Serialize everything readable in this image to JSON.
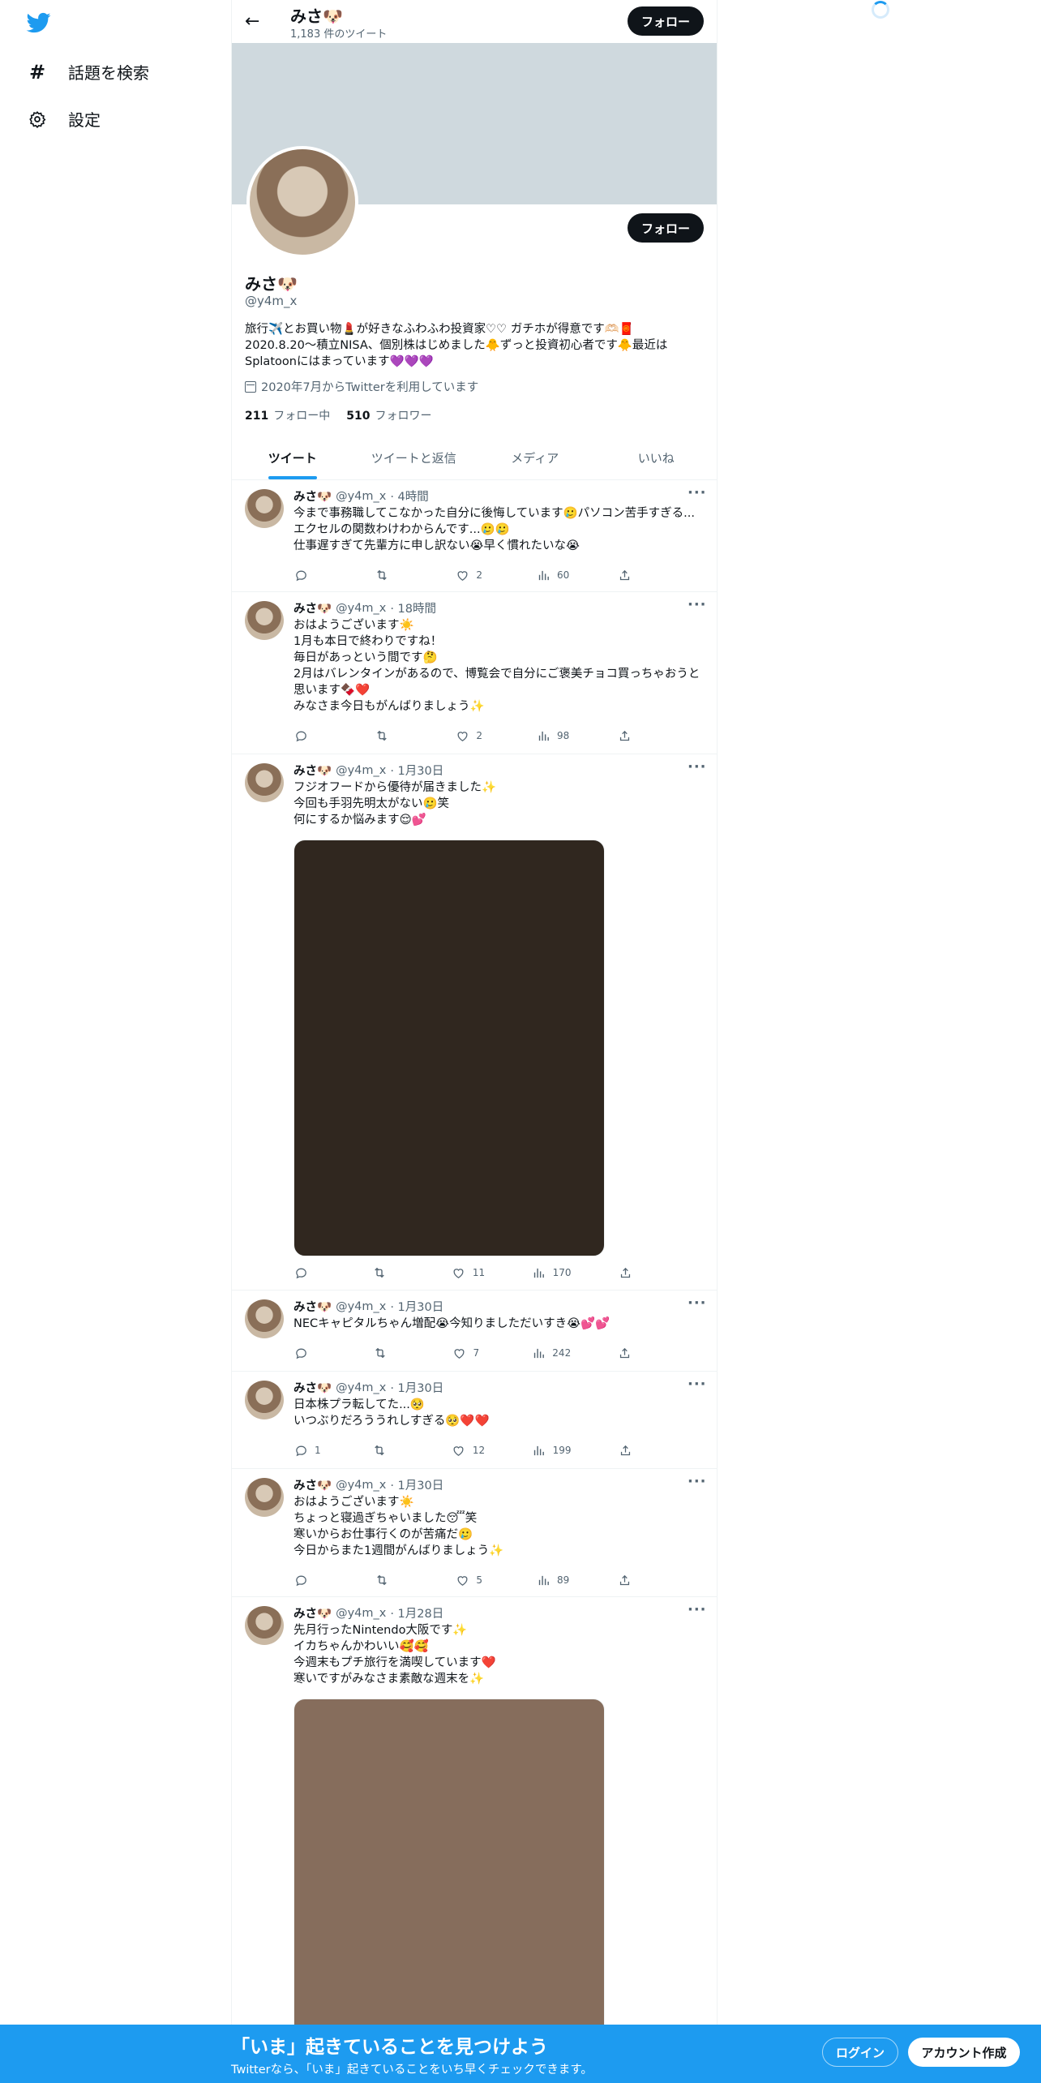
{
  "nav": {
    "logo": "twitter-bird-icon",
    "items": [
      {
        "label": "話題を検索",
        "icon": "hashtag-icon"
      },
      {
        "label": "設定",
        "icon": "gear-icon"
      }
    ]
  },
  "header": {
    "name": "みさ🐶",
    "tweet_count": "1,183 件のツイート",
    "follow_label": "フォロー"
  },
  "profile": {
    "name": "みさ🐶",
    "handle": "@y4m_x",
    "follow_label": "フォロー",
    "bio": "旅行✈️とお買い物💄が好きなふわふわ投資家♡♡ ガチホが得意です🫶🏻🧧\n2020.8.20〜積立NISA、個別株はじめました🐥ずっと投資初心者です🐥最近は\nSplatoonにはまっています💜💜💜",
    "joined": "2020年7月からTwitterを利用しています",
    "following_count": "211",
    "following_label": "フォロー中",
    "followers_count": "510",
    "followers_label": "フォロワー"
  },
  "tabs": [
    "ツイート",
    "ツイートと返信",
    "メディア",
    "いいね"
  ],
  "tweets": [
    {
      "name": "みさ🐶",
      "handle": "@y4m_x",
      "time": "· 4時間",
      "text": "今まで事務職してこなかった自分に後悔しています🥲パソコン苦手すぎる...エクセルの関数わけわからんです...🥲🥲\n仕事遅すぎて先輩方に申し訳ない😭早く慣れたいな😭",
      "replies": "",
      "retweets": "",
      "likes": "2",
      "views": "60"
    },
    {
      "name": "みさ🐶",
      "handle": "@y4m_x",
      "time": "· 18時間",
      "text": "おはようございます☀️\n1月も本日で終わりですね！\n毎日があっという間です🤔\n2月はバレンタインがあるので、博覧会で自分にご褒美チョコ買っちゃおうと思います🍫❤️\nみなさま今日もがんばりましょう✨",
      "replies": "",
      "retweets": "",
      "likes": "2",
      "views": "98"
    },
    {
      "name": "みさ🐶",
      "handle": "@y4m_x",
      "time": "· 1月30日",
      "text": "フジオフードから優待が届きました✨\n今回も手羽先明太がない🥲笑\n何にするか悩みます😌💕",
      "replies": "",
      "retweets": "",
      "likes": "11",
      "views": "170",
      "media_color": "#30271f"
    },
    {
      "name": "みさ🐶",
      "handle": "@y4m_x",
      "time": "· 1月30日",
      "text": "NECキャピタルちゃん増配😭今知りましただいすき😭💕💕",
      "replies": "",
      "retweets": "",
      "likes": "7",
      "views": "242"
    },
    {
      "name": "みさ🐶",
      "handle": "@y4m_x",
      "time": "· 1月30日",
      "text": "日本株プラ転してた...🥺\nいつぶりだろううれしすぎる🥺❤️❤️",
      "replies": "1",
      "retweets": "",
      "likes": "12",
      "views": "199"
    },
    {
      "name": "みさ🐶",
      "handle": "@y4m_x",
      "time": "· 1月30日",
      "text": "おはようございます☀️\nちょっと寝過ぎちゃいました😴笑\n寒いからお仕事行くのが苦痛だ🥲\n今日からまた1週間がんばりましょう✨",
      "replies": "",
      "retweets": "",
      "likes": "5",
      "views": "89"
    },
    {
      "name": "みさ🐶",
      "handle": "@y4m_x",
      "time": "· 1月28日",
      "text": "先月行ったNintendo大阪です✨\nイカちゃんかわいい🥰🥰\n今週末もプチ旅行を満喫しています❤️\n寒いですがみなさま素敵な週末を✨",
      "replies": "",
      "retweets": "",
      "likes": "",
      "views": "",
      "media_color": "#866d5c"
    }
  ],
  "action_icons": [
    "reply-icon",
    "retweet-icon",
    "like-icon",
    "views-icon",
    "share-icon"
  ],
  "bottom_bar": {
    "title": "「いま」起きていることを見つけよう",
    "subtitle": "Twitterなら、「いま」起きていることをいち早くチェックできます。",
    "login_label": "ログイン",
    "signup_label": "アカウント作成"
  }
}
